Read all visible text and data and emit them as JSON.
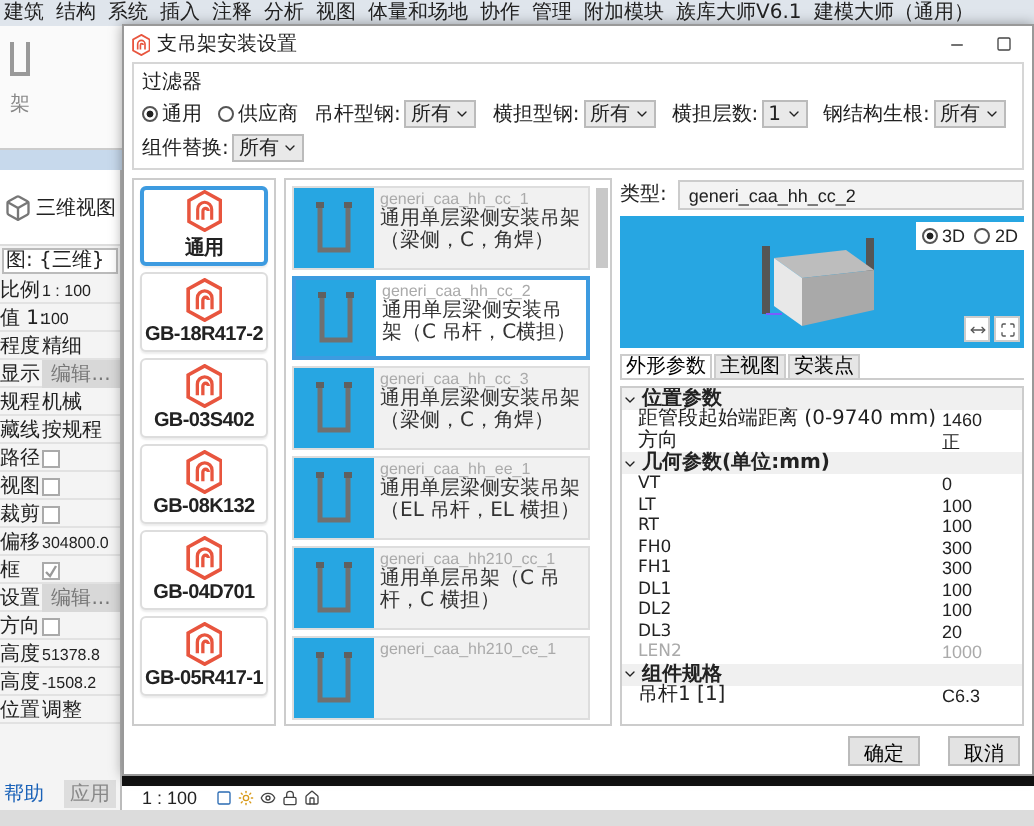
{
  "menu_bar": [
    "建筑",
    "结构",
    "系统",
    "插入",
    "注释",
    "分析",
    "视图",
    "体量和场地",
    "协作",
    "管理",
    "附加模块",
    "族库大师V6.1",
    "建模大师（通用）"
  ],
  "ribbon": {
    "tool_label": "架"
  },
  "view_panel": {
    "view_name": "三维视图",
    "view_selector": "图: {三维}"
  },
  "properties": [
    {
      "kind": "text",
      "label": "比例",
      "value": "1 : 100"
    },
    {
      "kind": "text",
      "label": "值 1:",
      "value": "100"
    },
    {
      "kind": "text",
      "label": "程度",
      "value": "精细"
    },
    {
      "kind": "button",
      "label": "显示",
      "value": "编辑..."
    },
    {
      "kind": "text",
      "label": "规程",
      "value": "机械"
    },
    {
      "kind": "text",
      "label": "藏线",
      "value": "按规程"
    },
    {
      "kind": "check",
      "label": "路径",
      "checked": false
    },
    {
      "kind": "check",
      "label": "视图",
      "checked": false
    },
    {
      "kind": "check",
      "label": "裁剪",
      "checked": false
    },
    {
      "kind": "text",
      "label": "偏移",
      "value": "304800.0"
    },
    {
      "kind": "check",
      "label": "框",
      "checked": true
    },
    {
      "kind": "button",
      "label": "设置",
      "value": "编辑..."
    },
    {
      "kind": "check",
      "label": "方向",
      "checked": false
    },
    {
      "kind": "text",
      "label": "高度",
      "value": "51378.8"
    },
    {
      "kind": "text",
      "label": "高度",
      "value": "-1508.2"
    },
    {
      "kind": "text",
      "label": "位置",
      "value": "调整"
    }
  ],
  "properties_footer": {
    "link": "帮助",
    "button": "应用"
  },
  "status_bar": {
    "scale": "1 : 100"
  },
  "dialog": {
    "title": "支吊架安装设置",
    "filter": {
      "title": "过滤器",
      "sources": [
        {
          "label": "通用",
          "selected": true
        },
        {
          "label": "供应商",
          "selected": false
        }
      ],
      "selects": [
        {
          "label": "吊杆型钢:",
          "value": "所有"
        },
        {
          "label": "横担型钢:",
          "value": "所有"
        },
        {
          "label": "横担层数:",
          "value": "1"
        },
        {
          "label": "钢结构生根:",
          "value": "所有"
        },
        {
          "label": "组件替换:",
          "value": "所有"
        }
      ]
    },
    "standards": [
      {
        "label": "通用",
        "selected": true
      },
      {
        "label": "GB-18R417-2",
        "selected": false
      },
      {
        "label": "GB-03S402",
        "selected": false
      },
      {
        "label": "GB-08K132",
        "selected": false
      },
      {
        "label": "GB-04D701",
        "selected": false
      },
      {
        "label": "GB-05R417-1",
        "selected": false
      }
    ],
    "hangers": [
      {
        "name": "generi_caa_hh_cc_1",
        "description": "通用单层梁侧安装吊架（梁侧，C，角焊）",
        "selected": false
      },
      {
        "name": "generi_caa_hh_cc_2",
        "description": "通用单层梁侧安装吊架（C 吊杆，C横担）",
        "selected": true
      },
      {
        "name": "generi_caa_hh_cc_3",
        "description": "通用单层梁侧安装吊架（梁侧，C，角焊）",
        "selected": false
      },
      {
        "name": "generi_caa_hh_ee_1",
        "description": "通用单层梁侧安装吊架（EL 吊杆，EL 横担）",
        "selected": false
      },
      {
        "name": "generi_caa_hh210_cc_1",
        "description": "通用单层吊架（C 吊杆，C 横担）",
        "selected": false
      },
      {
        "name": "generi_caa_hh210_ce_1",
        "selected": false
      }
    ],
    "type": {
      "label": "类型:",
      "value": "generi_caa_hh_cc_2"
    },
    "view_modes": [
      {
        "label": "3D",
        "selected": true
      },
      {
        "label": "2D",
        "selected": false
      }
    ],
    "param_tabs": [
      {
        "label": "外形参数",
        "selected": true
      },
      {
        "label": "主视图",
        "selected": false
      },
      {
        "label": "安装点",
        "selected": false
      }
    ],
    "param_groups": [
      {
        "title": "位置参数",
        "expanded": true,
        "rows": [
          {
            "name": "距管段起始端距离 (0-9740 mm)",
            "value": "1460",
            "disabled": false
          },
          {
            "name": "方向",
            "value": "正",
            "disabled": false
          }
        ]
      },
      {
        "title": "几何参数(单位:mm)",
        "expanded": true,
        "rows": [
          {
            "name": "VT",
            "value": "0",
            "disabled": false
          },
          {
            "name": "LT",
            "value": "100",
            "disabled": false
          },
          {
            "name": "RT",
            "value": "100",
            "disabled": false
          },
          {
            "name": "FH0",
            "value": "300",
            "disabled": false
          },
          {
            "name": "FH1",
            "value": "300",
            "disabled": false
          },
          {
            "name": "DL1",
            "value": "100",
            "disabled": false
          },
          {
            "name": "DL2",
            "value": "100",
            "disabled": false
          },
          {
            "name": "DL3",
            "value": "20",
            "disabled": false
          },
          {
            "name": "LEN2",
            "value": "1000",
            "disabled": true
          }
        ]
      },
      {
        "title": "组件规格",
        "expanded": true,
        "rows": [
          {
            "name": "吊杆1 [1]",
            "value": "C6.3",
            "disabled": false
          }
        ]
      }
    ],
    "buttons": [
      "确定",
      "取消"
    ]
  }
}
